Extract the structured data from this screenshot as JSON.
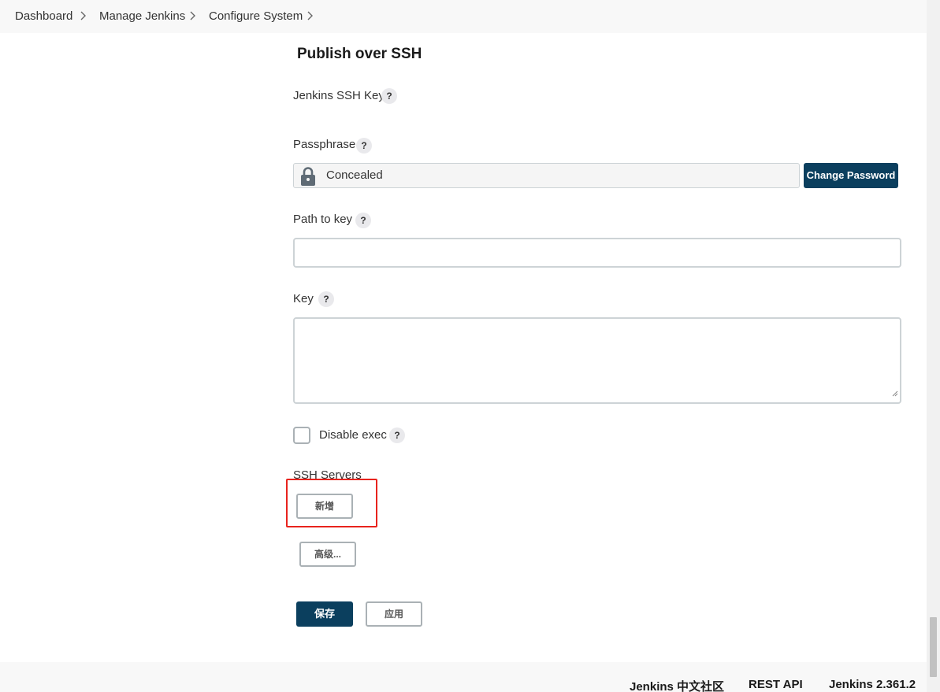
{
  "breadcrumb": [
    {
      "label": "Dashboard"
    },
    {
      "label": "Manage Jenkins"
    },
    {
      "label": "Configure System"
    }
  ],
  "section": {
    "title": "Publish over SSH"
  },
  "fields": {
    "ssh_key_label": "Jenkins SSH Key",
    "passphrase_label": "Passphrase",
    "passphrase_value": "Concealed",
    "change_password_label": "Change Password",
    "path_to_key_label": "Path to key",
    "path_to_key_value": "",
    "key_label": "Key",
    "key_value": "",
    "disable_exec_label": "Disable exec",
    "disable_exec_checked": false,
    "help_glyph": "?"
  },
  "ssh_servers": {
    "label": "SSH Servers",
    "add_label": "新增",
    "advanced_label": "高级..."
  },
  "actions": {
    "save_label": "保存",
    "apply_label": "应用"
  },
  "footer": {
    "community_label": "Jenkins 中文社区",
    "rest_api_label": "REST API",
    "version_label": "Jenkins 2.361.2"
  },
  "colors": {
    "primary_button": "#0b3f5e",
    "highlight_border": "#e8231d"
  },
  "icons": {
    "lock": "lock-icon",
    "help": "help-icon",
    "breadcrumb_separator": "chevron-right-icon"
  }
}
